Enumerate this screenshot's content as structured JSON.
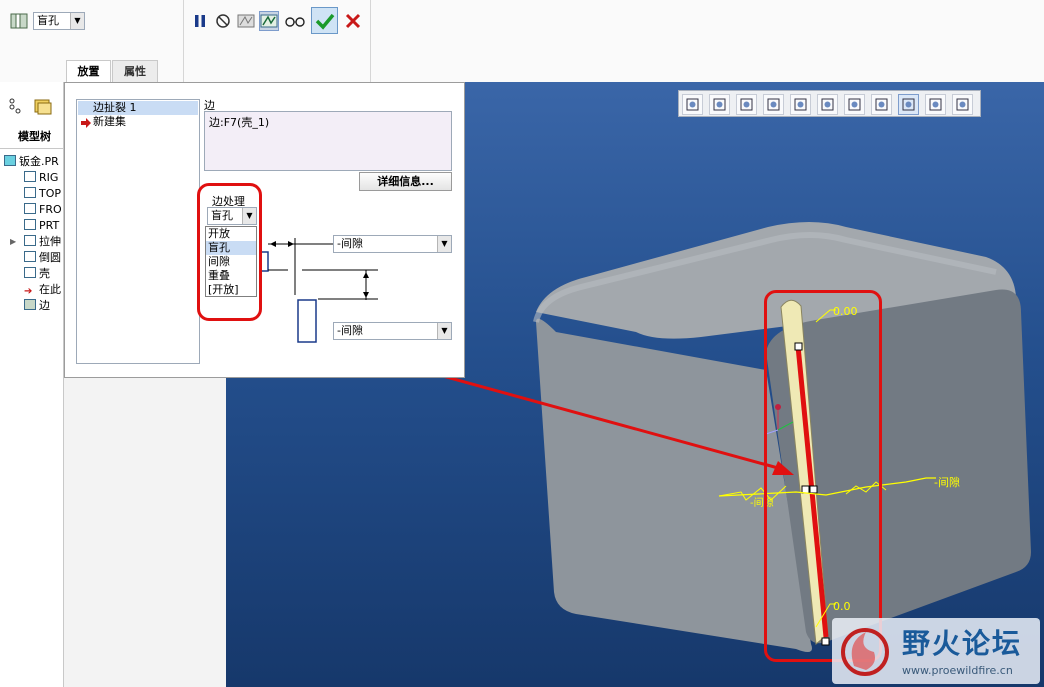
{
  "dashboard": {
    "feature_type": "盲孔",
    "tabs": [
      "放置",
      "属性"
    ],
    "active_tab": "放置",
    "tools": [
      "pause-icon",
      "no-preview-icon",
      "verify-off-icon",
      "verify-icon",
      "glasses-icon",
      "ok-check-icon",
      "cancel-x-icon"
    ]
  },
  "tree": {
    "header": "模型树",
    "items": [
      {
        "label": "钣金.PR",
        "icon": "sheetmetal-part-icon"
      },
      {
        "label": "RIG",
        "icon": "datum-plane-icon"
      },
      {
        "label": "TOP",
        "icon": "datum-plane-icon"
      },
      {
        "label": "FRO",
        "icon": "datum-plane-icon"
      },
      {
        "label": "PRT",
        "icon": "csys-icon"
      },
      {
        "label": "拉伸",
        "icon": "extrude-icon"
      },
      {
        "label": "倒圆",
        "icon": "round-icon"
      },
      {
        "label": "壳",
        "icon": "shell-icon"
      },
      {
        "label": "在此",
        "icon": "insert-here-icon"
      },
      {
        "label": "边",
        "icon": "edge-rip-icon"
      }
    ]
  },
  "panel": {
    "ref_items": [
      "边扯裂 1",
      "新建集"
    ],
    "edge_label": "边",
    "edge_value": "边:F7(壳_1)",
    "details_button": "详细信息...",
    "edge_treatment_label": "边处理",
    "edge_treatment_value": "盲孔",
    "dropdown_options": [
      "开放",
      "盲孔",
      "间隙",
      "重叠",
      "[开放]"
    ],
    "selected_option": "盲孔",
    "gap_combo_1": "-间隙",
    "gap_combo_2": "-间隙"
  },
  "viewport": {
    "dim_top": "0.00",
    "dim_bottom": "0.0",
    "gap_label_right": "-间隙",
    "gap_label_left": "-间隙",
    "view_tools": [
      "refit-icon",
      "zoom-in-icon",
      "zoom-out-icon",
      "repaint-icon",
      "display-style-icon",
      "saved-views-icon",
      "layers-icon",
      "datum-display-icon",
      "csys-display-icon",
      "annotation-display-icon",
      "spin-center-icon"
    ]
  },
  "watermark": {
    "title": "野火论坛",
    "url": "www.proewildfire.cn"
  },
  "colors": {
    "highlight_red": "#e01010",
    "viewport_top": "#3a66a8",
    "viewport_bottom": "#16386b",
    "dimension_yellow": "#ffff00"
  }
}
